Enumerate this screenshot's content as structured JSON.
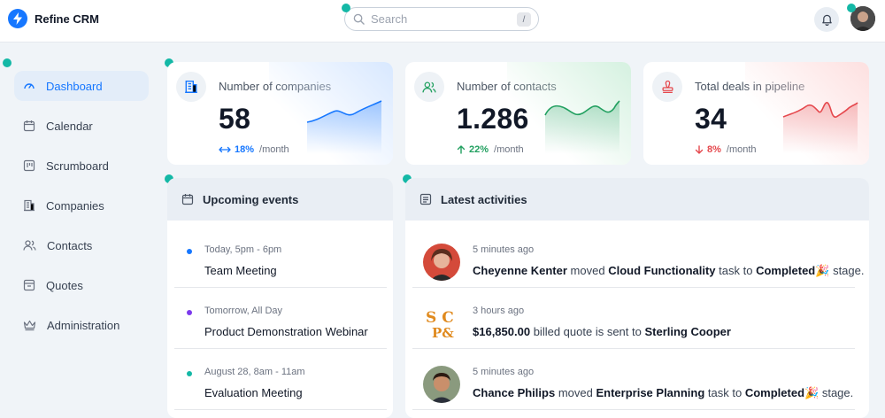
{
  "app": {
    "name": "Refine CRM"
  },
  "search": {
    "placeholder": "Search",
    "shortcut": "/"
  },
  "sidebar": {
    "items": [
      {
        "label": "Dashboard",
        "icon": "dashboard-icon",
        "active": true
      },
      {
        "label": "Calendar",
        "icon": "calendar-icon"
      },
      {
        "label": "Scrumboard",
        "icon": "scrumboard-icon"
      },
      {
        "label": "Companies",
        "icon": "building-icon"
      },
      {
        "label": "Contacts",
        "icon": "users-icon"
      },
      {
        "label": "Quotes",
        "icon": "container-icon"
      },
      {
        "label": "Administration",
        "icon": "crown-icon"
      }
    ]
  },
  "stats": [
    {
      "label": "Number of companies",
      "value": "58",
      "trend_pct": "18%",
      "trend_unit": "/month",
      "trend": "flat",
      "color": "#1677ff"
    },
    {
      "label": "Number of contacts",
      "value": "1.286",
      "trend_pct": "22%",
      "trend_unit": "/month",
      "trend": "up",
      "color": "#22a060"
    },
    {
      "label": "Total deals in pipeline",
      "value": "34",
      "trend_pct": "8%",
      "trend_unit": "/month",
      "trend": "down",
      "color": "#e5484d"
    }
  ],
  "events": {
    "title": "Upcoming events",
    "items": [
      {
        "time": "Today, 5pm - 6pm",
        "title": "Team Meeting",
        "color": "#1677ff"
      },
      {
        "time": "Tomorrow, All Day",
        "title": "Product Demonstration Webinar",
        "color": "#7c3aed"
      },
      {
        "time": "August 28, 8am - 11am",
        "title": "Evaluation Meeting",
        "color": "#14b8a6"
      }
    ]
  },
  "activities": {
    "title": "Latest activities",
    "items": [
      {
        "time": "5 minutes ago",
        "actor": "Cheyenne Kenter",
        "verb": "moved",
        "object": "Cloud Functionality",
        "mid": "task to",
        "target": "Completed",
        "emoji": "🎉",
        "tail": "stage."
      },
      {
        "time": "3 hours ago",
        "actor": "$16,850.00",
        "verb": "billed quote is sent to",
        "object": "Sterling Cooper",
        "mid": "",
        "target": "",
        "emoji": "",
        "tail": ""
      },
      {
        "time": "5 minutes ago",
        "actor": "Chance Philips",
        "verb": "moved",
        "object": "Enterprise Planning",
        "mid": "task to",
        "target": "Completed",
        "emoji": "🎉",
        "tail": "stage."
      }
    ]
  }
}
